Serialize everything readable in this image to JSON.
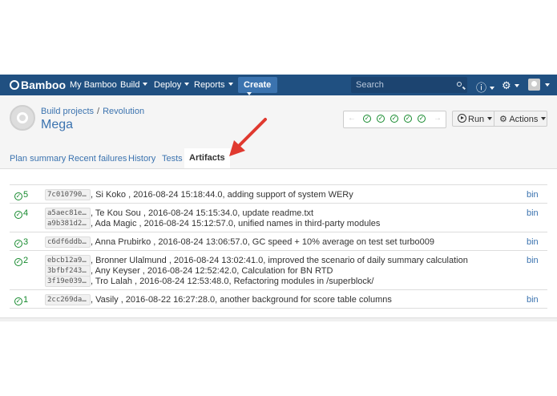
{
  "topbar": {
    "logo": "Bamboo",
    "nav": [
      "My Bamboo",
      "Build",
      "Deploy",
      "Reports"
    ],
    "create_label": "Create",
    "search_placeholder": "Search",
    "help_icon": "help-icon",
    "settings_icon": "gear-icon"
  },
  "header": {
    "breadcrumb": [
      "Build projects",
      "Revolution"
    ],
    "title": "Mega",
    "run_label": "Run",
    "actions_label": "Actions",
    "history_statuses": [
      "success",
      "success",
      "success",
      "success",
      "success"
    ]
  },
  "tabs": [
    "Plan summary",
    "Recent failures",
    "History",
    "Tests",
    "Artifacts"
  ],
  "active_tab": "Artifacts",
  "builds": [
    {
      "number": "5",
      "commits": [
        {
          "hash": "7c010790…",
          "text": ", Si Koko , 2016-08-24 15:18:44.0, adding support of system WERy"
        }
      ],
      "artifact": "bin"
    },
    {
      "number": "4",
      "commits": [
        {
          "hash": "a5aec81e…",
          "text": ", Te Kou Sou , 2016-08-24 15:15:34.0, update readme.txt"
        },
        {
          "hash": "a9b381d2…",
          "text": ", Ada Magic , 2016-08-24 15:12:57.0, unified names in third-party modules"
        }
      ],
      "artifact": "bin"
    },
    {
      "number": "3",
      "commits": [
        {
          "hash": "c6df6ddb…",
          "text": ", Anna Prubirko , 2016-08-24 13:06:57.0, GC speed + 10% average on test set turbo009"
        }
      ],
      "artifact": "bin"
    },
    {
      "number": "2",
      "commits": [
        {
          "hash": "ebcb12a9…",
          "text": ", Bronner Ulalmund , 2016-08-24 13:02:41.0, improved the scenario of daily summary calculation"
        },
        {
          "hash": "3bfbf243…",
          "text": ", Any Keyser , 2016-08-24 12:52:42.0, Calculation for BN RTD"
        },
        {
          "hash": "3f19e039…",
          "text": ", Tro Lalah , 2016-08-24 12:53:48.0, Refactoring modules in /superblock/"
        }
      ],
      "artifact": "bin"
    },
    {
      "number": "1",
      "commits": [
        {
          "hash": "2cc269da…",
          "text": ", Vasily , 2016-08-22 16:27:28.0, another background for score table columns"
        }
      ],
      "artifact": "bin"
    }
  ],
  "colors": {
    "topbar": "#205081",
    "link": "#3b73af",
    "success": "#14892c",
    "arrow": "#e0392f"
  }
}
